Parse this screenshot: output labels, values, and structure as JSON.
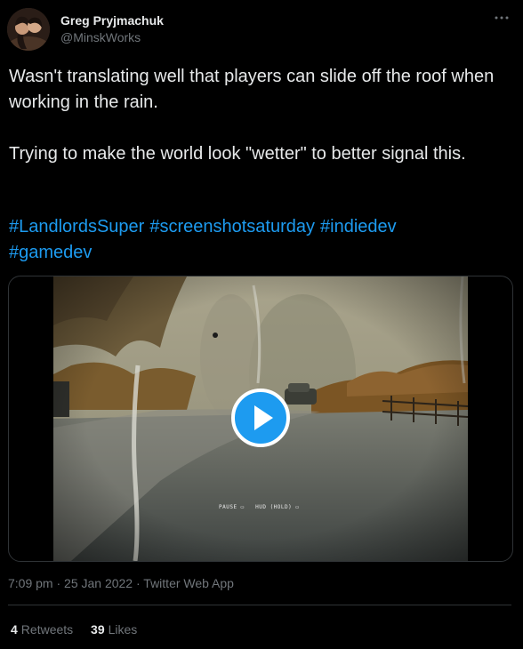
{
  "author": {
    "display_name": "Greg Pryjmachuk",
    "handle": "@MinskWorks"
  },
  "more_icon": "more-horizontal-icon",
  "tweet": {
    "text": "Wasn't translating well that players can slide off the roof when working in the rain.\n\nTrying to make the world look \"wetter\" to better signal this.",
    "hashtags": [
      "#LandlordsSuper",
      "#screenshotsaturday",
      "#indiedev",
      "#gamedev"
    ]
  },
  "media": {
    "play_icon": "play-icon",
    "hud": {
      "pause_label": "PAUSE",
      "hud_label": "HUD (HOLD)"
    }
  },
  "timestamp": "7:09 pm · 25 Jan 2022 · Twitter Web App",
  "stats": {
    "retweets_count": "4",
    "retweets_label": "Retweets",
    "likes_count": "39",
    "likes_label": "Likes"
  },
  "colors": {
    "background": "#000000",
    "text": "#e7e9ea",
    "secondary_text": "#71767b",
    "link": "#1d9bf0",
    "border": "#2f3336"
  }
}
